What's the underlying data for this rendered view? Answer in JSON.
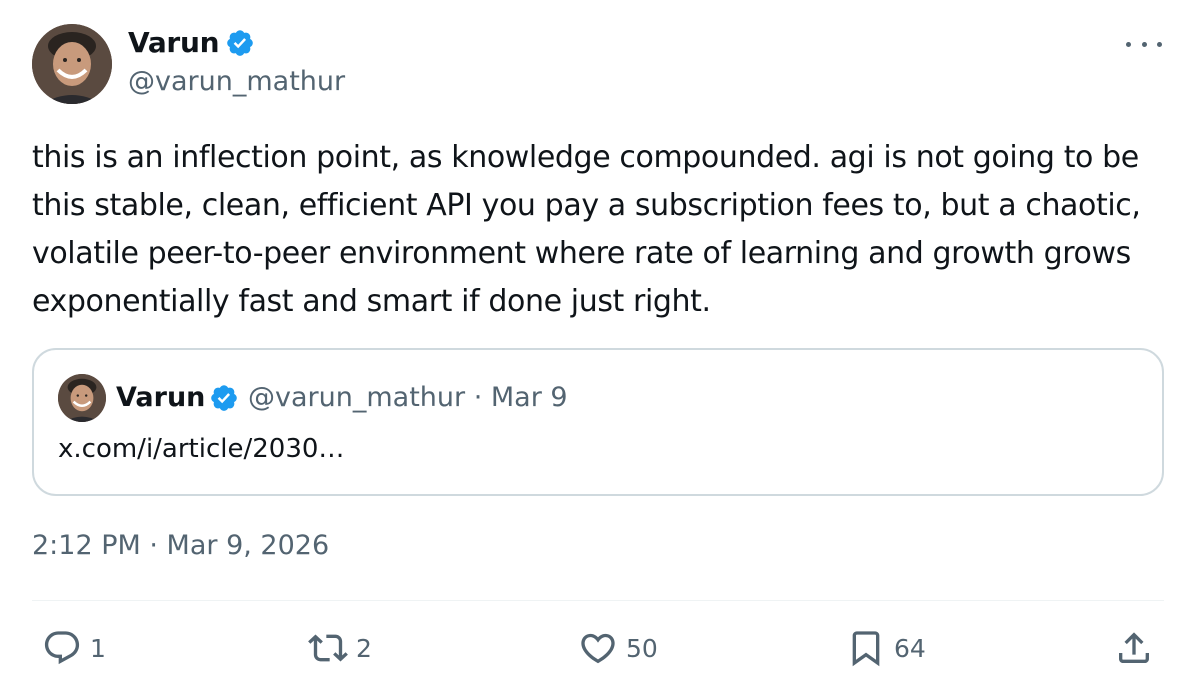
{
  "author": {
    "name": "Varun",
    "handle": "@varun_mathur",
    "verified": true
  },
  "tweet": {
    "text": "this is an inflection point, as knowledge compounded. agi is not going to be this stable, clean, efficient API you pay a subscription fees to, but a chaotic, volatile peer-to-peer environment where rate of learning and growth grows exponentially fast and smart if done just right.",
    "timestamp": "2:12 PM · Mar 9, 2026"
  },
  "quoted": {
    "name": "Varun",
    "meta": "@varun_mathur · Mar 9",
    "link": "x.com/i/article/2030…"
  },
  "actions": {
    "reply_count": "1",
    "retweet_count": "2",
    "like_count": "50",
    "bookmark_count": "64"
  },
  "icons": {
    "more": "more-horizontal-icon",
    "verified": "verified-badge-icon",
    "reply": "reply-icon",
    "retweet": "retweet-icon",
    "like": "heart-icon",
    "bookmark": "bookmark-icon",
    "share": "share-icon"
  },
  "colors": {
    "text": "#0f1419",
    "secondary": "#536471",
    "verified": "#1d9bf0",
    "border": "#cfd9de"
  }
}
